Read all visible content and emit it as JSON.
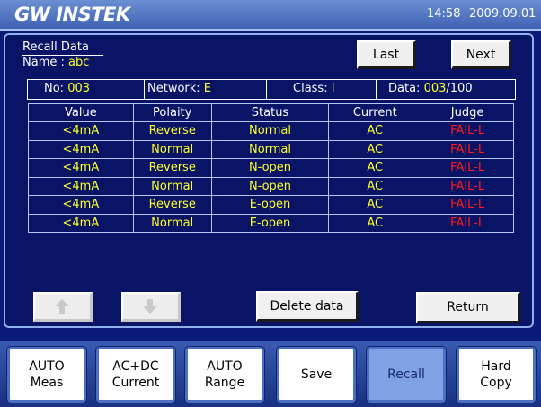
{
  "header": {
    "brand": "GW INSTEK",
    "time": "14:58",
    "date": "2009.09.01"
  },
  "recall": {
    "title": "Recall Data",
    "name_label": "Name : ",
    "name_value": "abc",
    "last_label": "Last",
    "next_label": "Next"
  },
  "info": {
    "no_label": "No: ",
    "no_value": "003",
    "network_label": "Network: ",
    "network_value": "E",
    "class_label": "Class: ",
    "class_value": "I",
    "data_label": "Data: ",
    "data_value": "003",
    "data_total": "/100"
  },
  "table": {
    "headers": [
      "Value",
      "Polaity",
      "Status",
      "Current",
      "Judge"
    ],
    "rows": [
      [
        "<4mA",
        "Reverse",
        "Normal",
        "AC",
        "FAIL-L"
      ],
      [
        "<4mA",
        "Normal",
        "Normal",
        "AC",
        "FAIL-L"
      ],
      [
        "<4mA",
        "Reverse",
        "N-open",
        "AC",
        "FAIL-L"
      ],
      [
        "<4mA",
        "Normal",
        "N-open",
        "AC",
        "FAIL-L"
      ],
      [
        "<4mA",
        "Reverse",
        "E-open",
        "AC",
        "FAIL-L"
      ],
      [
        "<4mA",
        "Normal",
        "E-open",
        "AC",
        "FAIL-L"
      ]
    ]
  },
  "controls": {
    "up_icon": "arrow-up-icon",
    "down_icon": "arrow-down-icon",
    "delete_label": "Delete data",
    "return_label": "Return"
  },
  "softkeys": [
    {
      "label": "AUTO\nMeas"
    },
    {
      "label": "AC+DC\nCurrent"
    },
    {
      "label": "AUTO\nRange"
    },
    {
      "label": "Save"
    },
    {
      "label": "Recall"
    },
    {
      "label": "Hard\nCopy"
    }
  ],
  "colors": {
    "background": "#0b1a78",
    "value_text": "#ffff2a",
    "fail_text": "#ff1a1a",
    "active_key": "#7fa2e4"
  }
}
